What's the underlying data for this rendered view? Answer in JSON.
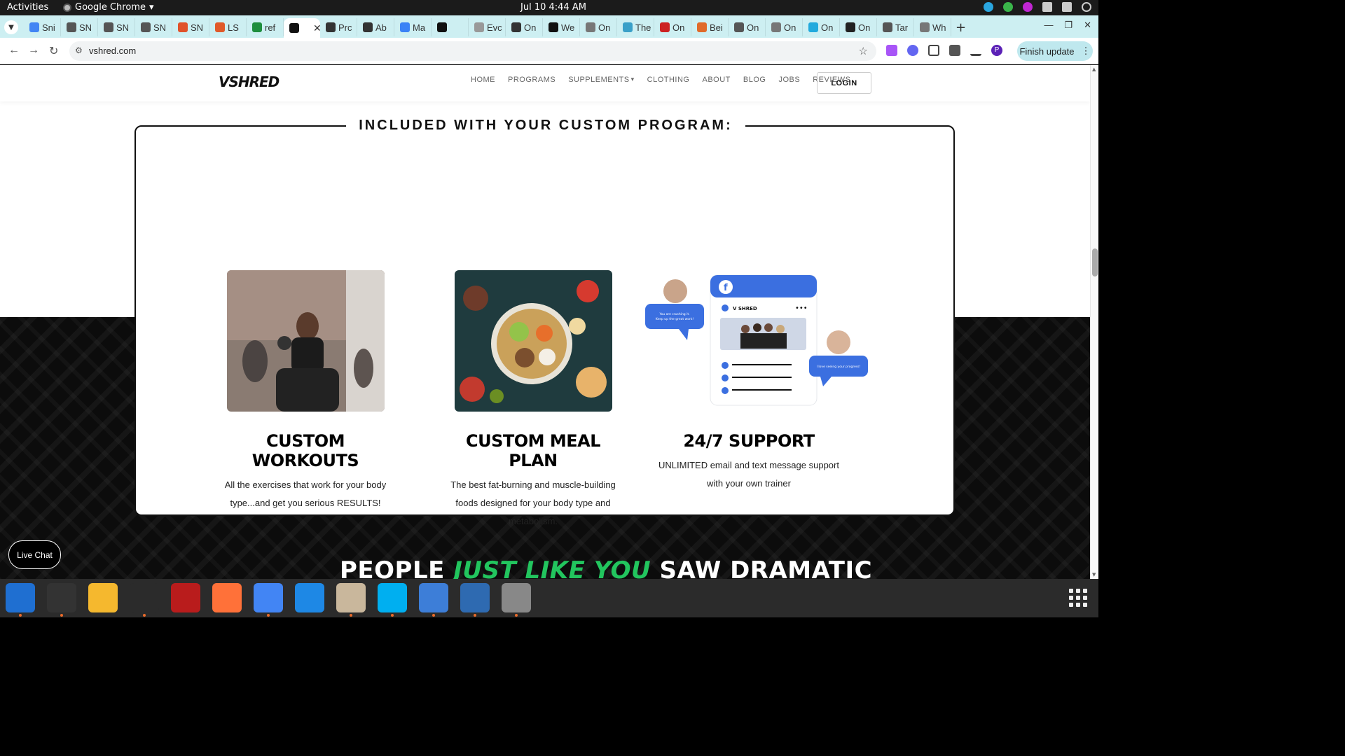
{
  "topbar": {
    "activities": "Activities",
    "app_name": "Google Chrome",
    "clock": "Jul 10  4:44 AM"
  },
  "tabs": [
    {
      "label": "Sni",
      "color": "#4285f4"
    },
    {
      "label": "SN",
      "color": "#555555"
    },
    {
      "label": "SN",
      "color": "#555555"
    },
    {
      "label": "SN",
      "color": "#555555"
    },
    {
      "label": "SN",
      "color": "#e0522a"
    },
    {
      "label": "LS",
      "color": "#e05a2a"
    },
    {
      "label": "ref",
      "color": "#1e8e3e"
    },
    {
      "label": "",
      "color": "#111111",
      "active": true
    },
    {
      "label": "Prc",
      "color": "#333333"
    },
    {
      "label": "Ab",
      "color": "#333333"
    },
    {
      "label": "Ma",
      "color": "#3b82f6"
    },
    {
      "label": "",
      "color": "#111111"
    },
    {
      "label": "Evc",
      "color": "#999999"
    },
    {
      "label": "On",
      "color": "#333333"
    },
    {
      "label": "We",
      "color": "#111111"
    },
    {
      "label": "On",
      "color": "#777777"
    },
    {
      "label": "The",
      "color": "#3aa0c8"
    },
    {
      "label": "On",
      "color": "#cc2222"
    },
    {
      "label": "Bei",
      "color": "#e06a2a"
    },
    {
      "label": "On",
      "color": "#555555"
    },
    {
      "label": "On",
      "color": "#777777"
    },
    {
      "label": "On",
      "color": "#22aadd"
    },
    {
      "label": "On",
      "color": "#222222"
    },
    {
      "label": "Tar",
      "color": "#555555"
    },
    {
      "label": "Wh",
      "color": "#777777"
    }
  ],
  "toolbar": {
    "url": "vshred.com",
    "finish_update": "Finish update",
    "profile_initial": "P"
  },
  "site": {
    "logo": "VSHRED",
    "nav": [
      "HOME",
      "PROGRAMS",
      "SUPPLEMENTS",
      "CLOTHING",
      "ABOUT",
      "BLOG",
      "JOBS",
      "REVIEWS"
    ],
    "login": "LOGIN"
  },
  "section": {
    "title": "INCLUDED WITH YOUR CUSTOM PROGRAM:",
    "features": [
      {
        "title": "CUSTOM WORKOUTS",
        "desc": "All the exercises that work for your body type...and get you serious RESULTS!"
      },
      {
        "title": "CUSTOM MEAL PLAN",
        "desc": "The best fat-burning and muscle-building foods designed for your body type and metabolism."
      },
      {
        "title": "24/7 SUPPORT",
        "desc": "UNLIMITED email and text message support with your own trainer"
      }
    ],
    "support_graphic": {
      "brand": "V SHRED",
      "bubble_left": "You are crushing it. Keep up the great work!",
      "bubble_right": "I love seeing your progress!"
    }
  },
  "headline": {
    "part1": "PEOPLE",
    "accent": "JUST LIKE YOU",
    "part2": "SAW DRAMATIC"
  },
  "live_chat": "Live Chat",
  "dock": [
    {
      "name": "thunderbird",
      "color": "#1f6fd1",
      "running": true
    },
    {
      "name": "terminal",
      "color": "#333333",
      "running": true
    },
    {
      "name": "text-editor-notes",
      "color": "#f5b82e",
      "running": false
    },
    {
      "name": "system-monitor",
      "color": "#2b2b2b",
      "running": true
    },
    {
      "name": "filezilla",
      "color": "#b91c1c",
      "running": false
    },
    {
      "name": "firefox",
      "color": "#ff7139",
      "running": false
    },
    {
      "name": "chrome",
      "color": "#4285f4",
      "running": true
    },
    {
      "name": "vscode",
      "color": "#1e88e5",
      "running": false
    },
    {
      "name": "files",
      "color": "#c9b79c",
      "running": true
    },
    {
      "name": "skype",
      "color": "#00aff0",
      "running": true
    },
    {
      "name": "text-editor",
      "color": "#3d7ed8",
      "running": true
    },
    {
      "name": "libreoffice-writer",
      "color": "#2e6ab1",
      "running": true
    },
    {
      "name": "disk-utility",
      "color": "#888888",
      "running": true
    }
  ]
}
